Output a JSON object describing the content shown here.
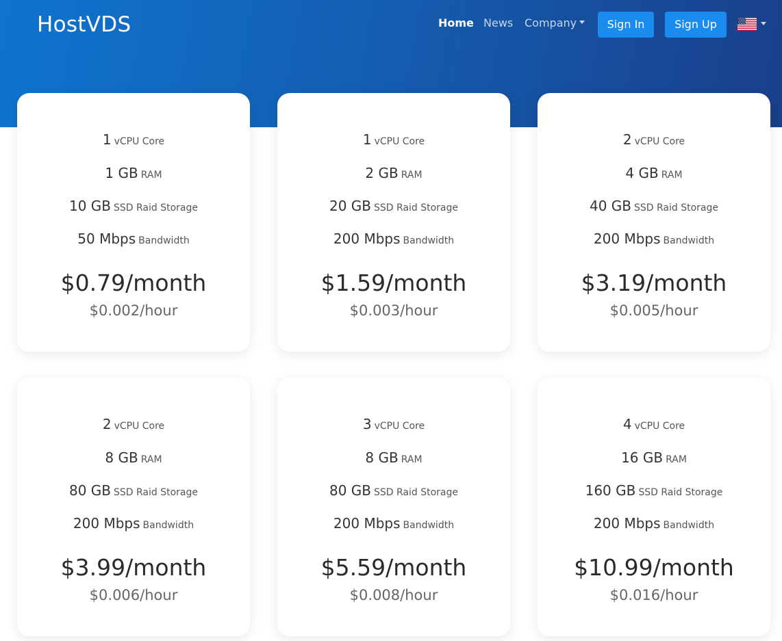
{
  "brand": "HostVDS",
  "nav": {
    "home": "Home",
    "news": "News",
    "company": "Company",
    "sign_in": "Sign In",
    "sign_up": "Sign Up",
    "language_icon": "us-flag-icon"
  },
  "colors": {
    "hero_start": "#0f74cf",
    "hero_end": "#1a3f8a",
    "button": "#1a8cf0"
  },
  "plans": [
    {
      "cpu": "1",
      "cpu_label": "vCPU Core",
      "ram": "1 GB",
      "ram_label": "RAM",
      "storage": "10 GB",
      "storage_label": "SSD Raid Storage",
      "bandwidth": "50 Mbps",
      "bandwidth_label": "Bandwidth",
      "price": "$0.79/month",
      "hourly": "$0.002/hour"
    },
    {
      "cpu": "1",
      "cpu_label": "vCPU Core",
      "ram": "2 GB",
      "ram_label": "RAM",
      "storage": "20 GB",
      "storage_label": "SSD Raid Storage",
      "bandwidth": "200 Mbps",
      "bandwidth_label": "Bandwidth",
      "price": "$1.59/month",
      "hourly": "$0.003/hour"
    },
    {
      "cpu": "2",
      "cpu_label": "vCPU Core",
      "ram": "4 GB",
      "ram_label": "RAM",
      "storage": "40 GB",
      "storage_label": "SSD Raid Storage",
      "bandwidth": "200 Mbps",
      "bandwidth_label": "Bandwidth",
      "price": "$3.19/month",
      "hourly": "$0.005/hour"
    },
    {
      "cpu": "2",
      "cpu_label": "vCPU Core",
      "ram": "8 GB",
      "ram_label": "RAM",
      "storage": "80 GB",
      "storage_label": "SSD Raid Storage",
      "bandwidth": "200 Mbps",
      "bandwidth_label": "Bandwidth",
      "price": "$3.99/month",
      "hourly": "$0.006/hour"
    },
    {
      "cpu": "3",
      "cpu_label": "vCPU Core",
      "ram": "8 GB",
      "ram_label": "RAM",
      "storage": "80 GB",
      "storage_label": "SSD Raid Storage",
      "bandwidth": "200 Mbps",
      "bandwidth_label": "Bandwidth",
      "price": "$5.59/month",
      "hourly": "$0.008/hour"
    },
    {
      "cpu": "4",
      "cpu_label": "vCPU Core",
      "ram": "16 GB",
      "ram_label": "RAM",
      "storage": "160 GB",
      "storage_label": "SSD Raid Storage",
      "bandwidth": "200 Mbps",
      "bandwidth_label": "Bandwidth",
      "price": "$10.99/month",
      "hourly": "$0.016/hour"
    }
  ]
}
